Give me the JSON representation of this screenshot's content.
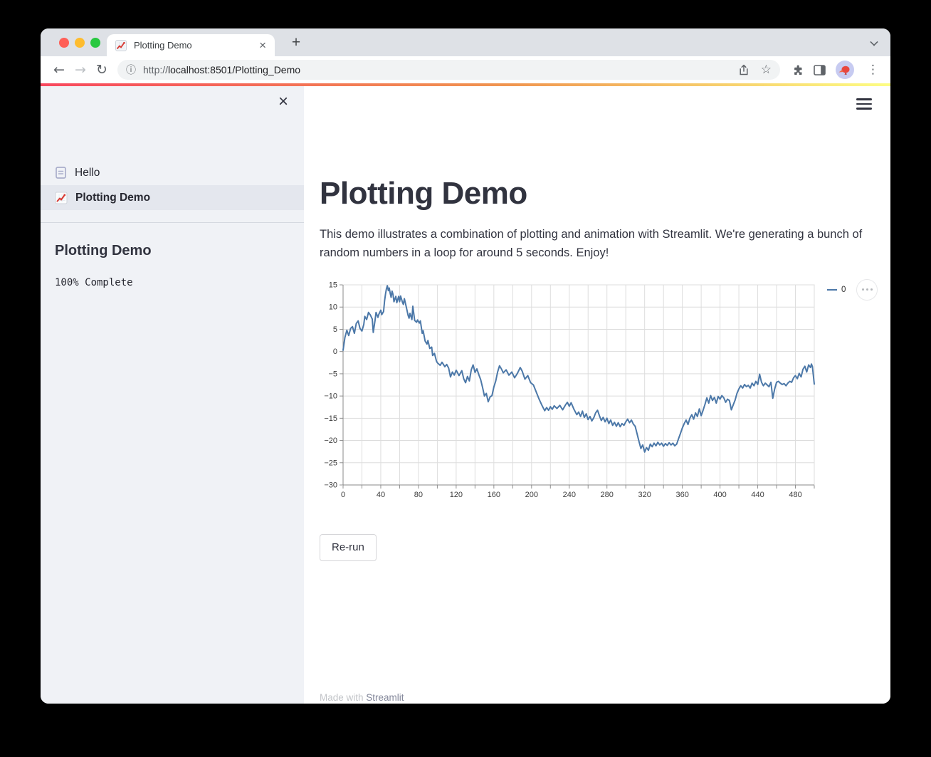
{
  "window": {
    "controls": {
      "close": "#ff5f57",
      "minimize": "#febc2e",
      "maximize": "#28c840"
    },
    "tab": {
      "title": "Plotting Demo",
      "favicon": "chart-increasing-emoji"
    },
    "toolbar": {
      "url_scheme": "http://",
      "url_host": "localhost:8501/Plotting_Demo"
    }
  },
  "icons": {
    "back": "←",
    "forward": "→",
    "reload": "↻",
    "info": "ⓘ",
    "star": "☆",
    "menu_dots": "⋮",
    "close": "×",
    "new_tab": "+"
  },
  "sidebar": {
    "nav": [
      {
        "label": "Hello",
        "icon": "page-document-icon",
        "selected": false
      },
      {
        "label": "Plotting Demo",
        "icon": "chart-increasing-icon",
        "selected": true
      }
    ],
    "section_title": "Plotting Demo",
    "progress_text": "100% Complete"
  },
  "main": {
    "title": "Plotting Demo",
    "description": "This demo illustrates a combination of plotting and animation with Streamlit. We're generating a bunch of random numbers in a loop for around 5 seconds. Enjoy!",
    "rerun_label": "Re-run",
    "footer_prefix": "Made with ",
    "footer_link": "Streamlit"
  },
  "colors": {
    "decoration_gradient": [
      "#f8485e",
      "#f0954f",
      "#fdfd84"
    ],
    "sidebar_bg": "#f0f2f6",
    "text_dark": "#31333f",
    "chart_line": "#4c78a8"
  },
  "chart_data": {
    "type": "line",
    "title": "",
    "xlabel": "",
    "ylabel": "",
    "xlim": [
      0,
      500
    ],
    "ylim": [
      -30,
      15
    ],
    "x_tick_step": 20,
    "x_label_step": 40,
    "y_tick_step": 5,
    "grid": true,
    "grid_color": "#dddddd",
    "axis_color": "#888888",
    "tick_color": "#909090",
    "legend_position": "top-right",
    "series": [
      {
        "name": "0",
        "color": "#4c78a8",
        "points": [
          [
            0,
            0.3
          ],
          [
            2,
            3.2
          ],
          [
            4,
            4.8
          ],
          [
            6,
            3.6
          ],
          [
            8,
            5.2
          ],
          [
            10,
            5.6
          ],
          [
            12,
            4.1
          ],
          [
            14,
            6.3
          ],
          [
            16,
            6.9
          ],
          [
            18,
            5.2
          ],
          [
            20,
            4.6
          ],
          [
            22,
            6.1
          ],
          [
            23,
            7.9
          ],
          [
            25,
            7.2
          ],
          [
            27,
            8.8
          ],
          [
            29,
            8.2
          ],
          [
            31,
            7.3
          ],
          [
            32,
            4.3
          ],
          [
            34,
            7.1
          ],
          [
            35,
            8.8
          ],
          [
            37,
            7.7
          ],
          [
            38,
            8.4
          ],
          [
            40,
            9.3
          ],
          [
            41,
            8.3
          ],
          [
            43,
            9.0
          ],
          [
            44,
            11.4
          ],
          [
            45,
            12.9
          ],
          [
            46,
            14.1
          ],
          [
            47,
            14.8
          ],
          [
            48,
            13.7
          ],
          [
            49,
            14.3
          ],
          [
            50,
            13.1
          ],
          [
            51,
            12.2
          ],
          [
            52,
            13.6
          ],
          [
            53,
            12.8
          ],
          [
            54,
            11.2
          ],
          [
            56,
            12.4
          ],
          [
            57,
            11.0
          ],
          [
            58,
            11.7
          ],
          [
            59,
            12.4
          ],
          [
            60,
            11.2
          ],
          [
            61,
            12.5
          ],
          [
            63,
            11.1
          ],
          [
            64,
            10.6
          ],
          [
            65,
            11.9
          ],
          [
            67,
            10.1
          ],
          [
            69,
            8.1
          ],
          [
            70,
            7.5
          ],
          [
            71,
            8.6
          ],
          [
            73,
            7.2
          ],
          [
            74,
            10.2
          ],
          [
            76,
            7.0
          ],
          [
            78,
            6.6
          ],
          [
            79,
            7.1
          ],
          [
            81,
            6.4
          ],
          [
            82,
            6.9
          ],
          [
            84,
            4.1
          ],
          [
            85,
            4.7
          ],
          [
            87,
            2.4
          ],
          [
            89,
            1.7
          ],
          [
            90,
            2.5
          ],
          [
            92,
            0.7
          ],
          [
            94,
            1.0
          ],
          [
            95,
            -0.9
          ],
          [
            97,
            -0.4
          ],
          [
            99,
            -2.1
          ],
          [
            100,
            -2.5
          ],
          [
            103,
            -3.1
          ],
          [
            105,
            -2.4
          ],
          [
            108,
            -3.4
          ],
          [
            110,
            -2.9
          ],
          [
            112,
            -3.7
          ],
          [
            114,
            -5.7
          ],
          [
            116,
            -4.6
          ],
          [
            118,
            -5.3
          ],
          [
            120,
            -4.2
          ],
          [
            123,
            -5.4
          ],
          [
            126,
            -4.3
          ],
          [
            128,
            -6.1
          ],
          [
            130,
            -7.0
          ],
          [
            132,
            -5.6
          ],
          [
            134,
            -6.6
          ],
          [
            136,
            -4.1
          ],
          [
            138,
            -3.0
          ],
          [
            140,
            -4.7
          ],
          [
            142,
            -3.9
          ],
          [
            144,
            -5.2
          ],
          [
            146,
            -6.3
          ],
          [
            148,
            -8.1
          ],
          [
            150,
            -10.0
          ],
          [
            152,
            -9.4
          ],
          [
            154,
            -11.3
          ],
          [
            156,
            -10.2
          ],
          [
            158,
            -9.9
          ],
          [
            160,
            -8.0
          ],
          [
            162,
            -6.6
          ],
          [
            164,
            -4.6
          ],
          [
            166,
            -3.2
          ],
          [
            168,
            -3.9
          ],
          [
            170,
            -4.8
          ],
          [
            173,
            -4.1
          ],
          [
            176,
            -5.3
          ],
          [
            179,
            -4.6
          ],
          [
            182,
            -5.9
          ],
          [
            185,
            -4.9
          ],
          [
            188,
            -3.6
          ],
          [
            190,
            -4.4
          ],
          [
            193,
            -6.2
          ],
          [
            196,
            -5.4
          ],
          [
            199,
            -7.0
          ],
          [
            202,
            -7.5
          ],
          [
            205,
            -9.1
          ],
          [
            208,
            -10.7
          ],
          [
            211,
            -12.1
          ],
          [
            214,
            -13.3
          ],
          [
            216,
            -12.6
          ],
          [
            218,
            -13.2
          ],
          [
            220,
            -12.4
          ],
          [
            222,
            -13.0
          ],
          [
            224,
            -12.2
          ],
          [
            227,
            -12.8
          ],
          [
            230,
            -12.1
          ],
          [
            233,
            -13.1
          ],
          [
            236,
            -12.0
          ],
          [
            238,
            -11.4
          ],
          [
            240,
            -12.3
          ],
          [
            242,
            -11.5
          ],
          [
            245,
            -13.0
          ],
          [
            248,
            -14.2
          ],
          [
            250,
            -13.6
          ],
          [
            252,
            -14.6
          ],
          [
            254,
            -13.4
          ],
          [
            256,
            -14.8
          ],
          [
            258,
            -14.0
          ],
          [
            260,
            -15.3
          ],
          [
            262,
            -14.6
          ],
          [
            264,
            -15.6
          ],
          [
            266,
            -14.9
          ],
          [
            268,
            -13.8
          ],
          [
            270,
            -13.2
          ],
          [
            272,
            -14.4
          ],
          [
            274,
            -15.5
          ],
          [
            276,
            -14.8
          ],
          [
            278,
            -15.8
          ],
          [
            280,
            -15.0
          ],
          [
            282,
            -16.2
          ],
          [
            284,
            -15.4
          ],
          [
            286,
            -16.6
          ],
          [
            288,
            -15.9
          ],
          [
            290,
            -16.8
          ],
          [
            292,
            -16.0
          ],
          [
            294,
            -16.9
          ],
          [
            296,
            -16.2
          ],
          [
            298,
            -16.6
          ],
          [
            300,
            -15.8
          ],
          [
            302,
            -15.2
          ],
          [
            304,
            -16.0
          ],
          [
            306,
            -15.4
          ],
          [
            308,
            -16.3
          ],
          [
            310,
            -16.8
          ],
          [
            312,
            -18.5
          ],
          [
            314,
            -20.2
          ],
          [
            316,
            -21.8
          ],
          [
            318,
            -21.0
          ],
          [
            320,
            -22.6
          ],
          [
            322,
            -21.6
          ],
          [
            324,
            -22.2
          ],
          [
            326,
            -20.8
          ],
          [
            328,
            -21.4
          ],
          [
            330,
            -20.6
          ],
          [
            332,
            -21.2
          ],
          [
            334,
            -20.4
          ],
          [
            336,
            -21.0
          ],
          [
            338,
            -20.6
          ],
          [
            340,
            -21.3
          ],
          [
            342,
            -20.7
          ],
          [
            344,
            -21.1
          ],
          [
            346,
            -20.5
          ],
          [
            348,
            -21.0
          ],
          [
            350,
            -20.6
          ],
          [
            352,
            -21.2
          ],
          [
            354,
            -20.8
          ],
          [
            356,
            -19.6
          ],
          [
            358,
            -18.4
          ],
          [
            360,
            -17.2
          ],
          [
            362,
            -16.2
          ],
          [
            364,
            -15.4
          ],
          [
            366,
            -16.4
          ],
          [
            368,
            -15.0
          ],
          [
            370,
            -14.2
          ],
          [
            372,
            -15.2
          ],
          [
            374,
            -13.8
          ],
          [
            376,
            -14.6
          ],
          [
            378,
            -12.9
          ],
          [
            380,
            -14.4
          ],
          [
            382,
            -13.2
          ],
          [
            384,
            -11.9
          ],
          [
            386,
            -10.4
          ],
          [
            388,
            -11.6
          ],
          [
            390,
            -9.9
          ],
          [
            392,
            -11.0
          ],
          [
            394,
            -10.3
          ],
          [
            396,
            -11.6
          ],
          [
            398,
            -10.1
          ],
          [
            400,
            -10.7
          ],
          [
            402,
            -9.9
          ],
          [
            404,
            -10.4
          ],
          [
            406,
            -11.4
          ],
          [
            408,
            -10.7
          ],
          [
            410,
            -11.0
          ],
          [
            412,
            -13.1
          ],
          [
            414,
            -12.0
          ],
          [
            416,
            -10.9
          ],
          [
            418,
            -9.4
          ],
          [
            420,
            -8.4
          ],
          [
            422,
            -7.7
          ],
          [
            424,
            -8.2
          ],
          [
            426,
            -7.4
          ],
          [
            428,
            -7.9
          ],
          [
            430,
            -7.6
          ],
          [
            432,
            -8.2
          ],
          [
            434,
            -7.1
          ],
          [
            436,
            -7.7
          ],
          [
            438,
            -6.7
          ],
          [
            440,
            -7.4
          ],
          [
            442,
            -5.1
          ],
          [
            444,
            -6.9
          ],
          [
            446,
            -7.7
          ],
          [
            448,
            -7.1
          ],
          [
            450,
            -7.5
          ],
          [
            452,
            -7.9
          ],
          [
            454,
            -6.9
          ],
          [
            456,
            -10.5
          ],
          [
            458,
            -8.4
          ],
          [
            460,
            -6.9
          ],
          [
            462,
            -6.7
          ],
          [
            464,
            -7.1
          ],
          [
            466,
            -7.4
          ],
          [
            468,
            -7.2
          ],
          [
            470,
            -7.7
          ],
          [
            472,
            -7.1
          ],
          [
            474,
            -6.7
          ],
          [
            476,
            -6.9
          ],
          [
            478,
            -5.9
          ],
          [
            480,
            -5.4
          ],
          [
            482,
            -6.1
          ],
          [
            484,
            -4.9
          ],
          [
            486,
            -5.7
          ],
          [
            488,
            -4.0
          ],
          [
            490,
            -3.3
          ],
          [
            492,
            -4.6
          ],
          [
            494,
            -3.0
          ],
          [
            496,
            -3.6
          ],
          [
            497,
            -2.8
          ],
          [
            498,
            -3.4
          ],
          [
            500,
            -7.3
          ]
        ]
      }
    ]
  }
}
